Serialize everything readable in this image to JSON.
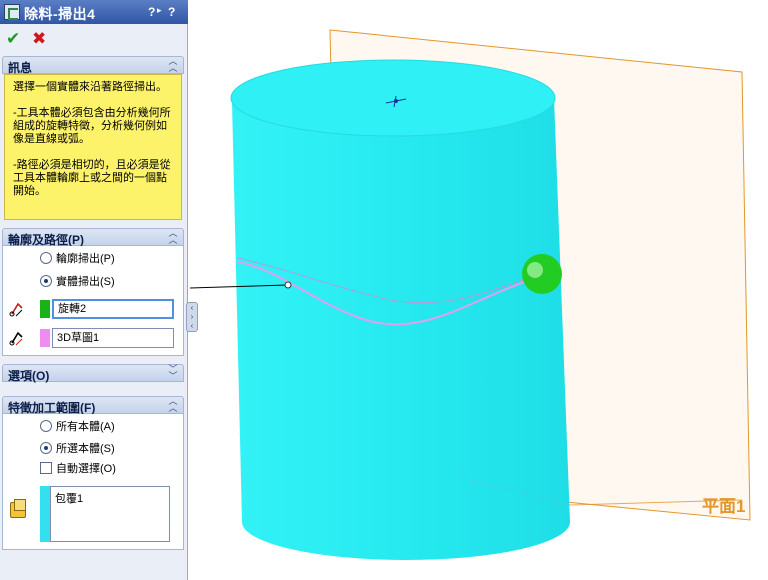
{
  "window": {
    "title": "除料-掃出4",
    "help_label": "?",
    "help_arrow": "▸",
    "close_label": "?"
  },
  "actions": {
    "ok_symbol": "✔",
    "cancel_symbol": "✖"
  },
  "message_section": {
    "header": "訊息",
    "paragraphs": [
      "選擇一個實體來沿著路徑掃出。",
      "-工具本體必須包含由分析幾何所組成的旋轉特徵，分析幾何例如像是直線或弧。",
      "-路徑必須是相切的，且必須是從工具本體輪廓上或之間的一個點開始。"
    ]
  },
  "profile_section": {
    "header": "輪廓及路徑(P)",
    "options": [
      {
        "label": "輪廓掃出(P)",
        "selected": false
      },
      {
        "label": "實體掃出(S)",
        "selected": true
      }
    ],
    "tool_body_value": "旋轉2",
    "tool_body_color": "#17b317",
    "path_value": "3D草圖1",
    "path_color": "#f08cf0"
  },
  "options_section": {
    "header": "選項(O)"
  },
  "scope_section": {
    "header": "特徵加工範圍(F)",
    "options": [
      {
        "label": "所有本體(A)",
        "selected": false
      },
      {
        "label": "所選本體(S)",
        "selected": true
      }
    ],
    "auto_select_label": "自動選擇(O)",
    "auto_select_checked": false,
    "bodies_list": [
      "包覆1"
    ]
  },
  "viewport": {
    "plane_label": "平面1",
    "cylinder_color": "#2ef0f5",
    "plane_color": "#e3962b",
    "sweep_body_color": "#22cc22"
  }
}
